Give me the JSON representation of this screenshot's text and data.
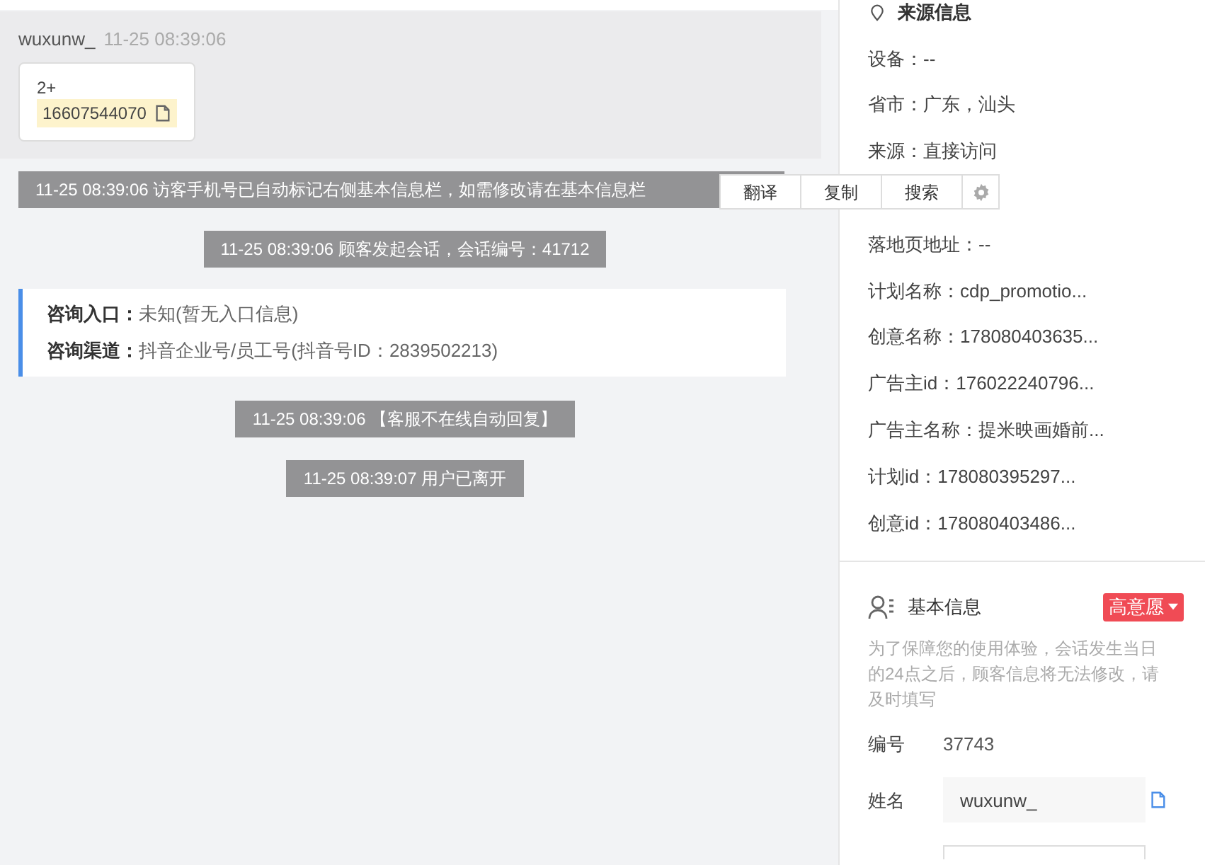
{
  "message": {
    "sender": "wuxunw_",
    "time": "11-25 08:39:06",
    "line_1": "2+",
    "phone": "16607544070"
  },
  "system_notes": [
    {
      "text": "11-25 08:39:06 访客手机号已自动标记右侧基本信息栏，如需修改请在基本信息栏",
      "kind": "wide"
    },
    {
      "text": "11-25 08:39:06 顾客发起会话，会话编号：41712",
      "kind": "centered"
    }
  ],
  "consult_card": [
    {
      "label": "咨询入口：",
      "value": "未知(暂无入口信息)"
    },
    {
      "label": "咨询渠道：",
      "value": "抖音企业号/员工号(抖音号ID：2839502213)"
    }
  ],
  "system_notes_2": [
    {
      "text": "11-25 08:39:06 【客服不在线自动回复】"
    },
    {
      "text": "11-25 08:39:07 用户已离开"
    }
  ],
  "context_menu": {
    "items": [
      "翻译",
      "复制",
      "搜索"
    ]
  },
  "source_info": {
    "title": "来源信息",
    "rows": [
      {
        "text": "设备：--"
      },
      {
        "text": "省市：广东，汕头"
      },
      {
        "text": "来源：直接访问"
      },
      {
        "text": "落地页地址：--"
      },
      {
        "text": "计划名称：cdp_promotio..."
      },
      {
        "text": "创意名称：178080403635..."
      },
      {
        "text": "广告主id：176022240796..."
      },
      {
        "text": "广告主名称：提米映画婚前..."
      },
      {
        "text": "计划id：178080395297..."
      },
      {
        "text": "创意id：178080403486..."
      }
    ]
  },
  "basic_info": {
    "title": "基本信息",
    "intent": "高意愿",
    "notice": "为了保障您的使用体验，会话发生当日的24点之后，顾客信息将无法修改，请及时填写",
    "number_label": "编号",
    "number": "37743",
    "name_label": "姓名",
    "name_value": "wuxunw_"
  }
}
